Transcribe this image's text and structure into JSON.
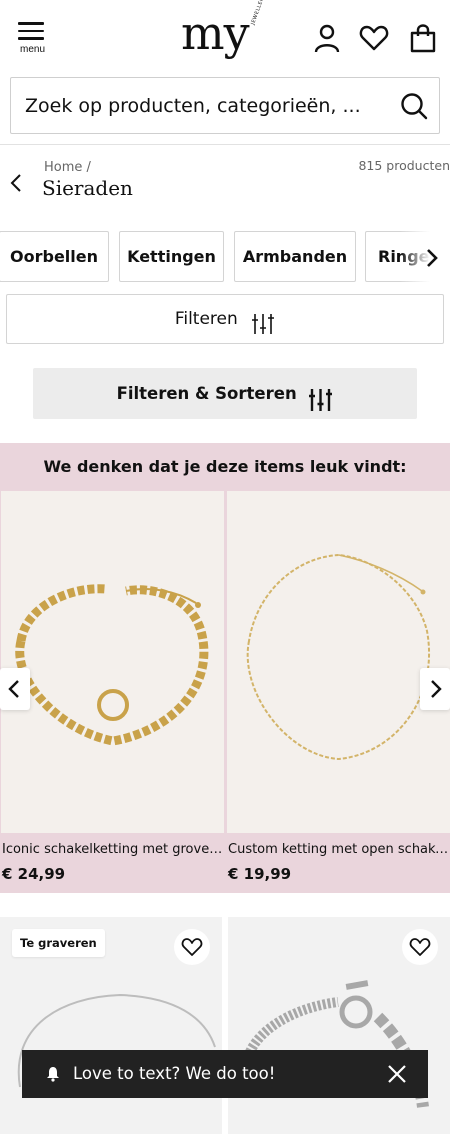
{
  "header": {
    "menu_label": "menu",
    "logo_text": "my",
    "logo_sub": "JEWELLERY",
    "icons": [
      "account-icon",
      "wishlist-heart-icon",
      "bag-icon"
    ]
  },
  "search": {
    "placeholder": "Zoek op producten, categorieën, ..."
  },
  "breadcrumb": {
    "home": "Home /",
    "title": "Sieraden",
    "count": "815 producten"
  },
  "categories": [
    "Oorbellen",
    "Kettingen",
    "Armbanden",
    "Ringen"
  ],
  "filters": {
    "filter_label": "Filteren",
    "sort_label": "Filteren & Sorteren"
  },
  "recommendations": {
    "title": "We denken dat je deze items leuk vindt:",
    "items": [
      {
        "name": "Iconic schakelketting met grove schakels",
        "price": "€ 24,99"
      },
      {
        "name": "Custom ketting met open schakels",
        "price": "€ 19,99"
      }
    ]
  },
  "products": [
    {
      "badge": "Te graveren"
    },
    {
      "badge": ""
    }
  ],
  "toast": {
    "message": "Love to text? We do too!"
  },
  "colors": {
    "recommend_bg": "#ead5dc",
    "toast_bg": "#222222",
    "sort_btn_bg": "#ececec"
  }
}
